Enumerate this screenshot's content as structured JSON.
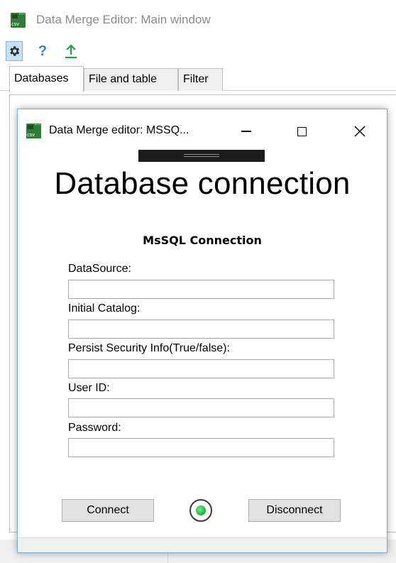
{
  "main_window": {
    "title": "Data Merge Editor: Main window",
    "icon_text": "csv"
  },
  "toolbar": {
    "help_label": "?",
    "icons": [
      "gear-icon",
      "help-icon",
      "upload-arrow-icon"
    ]
  },
  "tabs": [
    {
      "label": "Databases",
      "active": true
    },
    {
      "label": "File and table",
      "active": false
    },
    {
      "label": "Filter",
      "active": false
    }
  ],
  "dialog": {
    "title": "Data Merge editor: MSSQ...",
    "heading": "Database connection",
    "sub_heading": "MsSQL Connection",
    "fields": [
      {
        "label": "DataSource:",
        "value": ""
      },
      {
        "label": "Initial Catalog:",
        "value": ""
      },
      {
        "label": "Persist Security Info(True/false):",
        "value": ""
      },
      {
        "label": "User ID:",
        "value": ""
      },
      {
        "label": "Password:",
        "value": ""
      }
    ],
    "connect_label": "Connect",
    "disconnect_label": "Disconnect",
    "status_color": "#16b23c"
  },
  "colors": {
    "app_icon": "#2e7d32",
    "upload_arrow": "#1aa34a",
    "help": "#2f86c9",
    "selected_toolbar": "#c8e1f5"
  }
}
